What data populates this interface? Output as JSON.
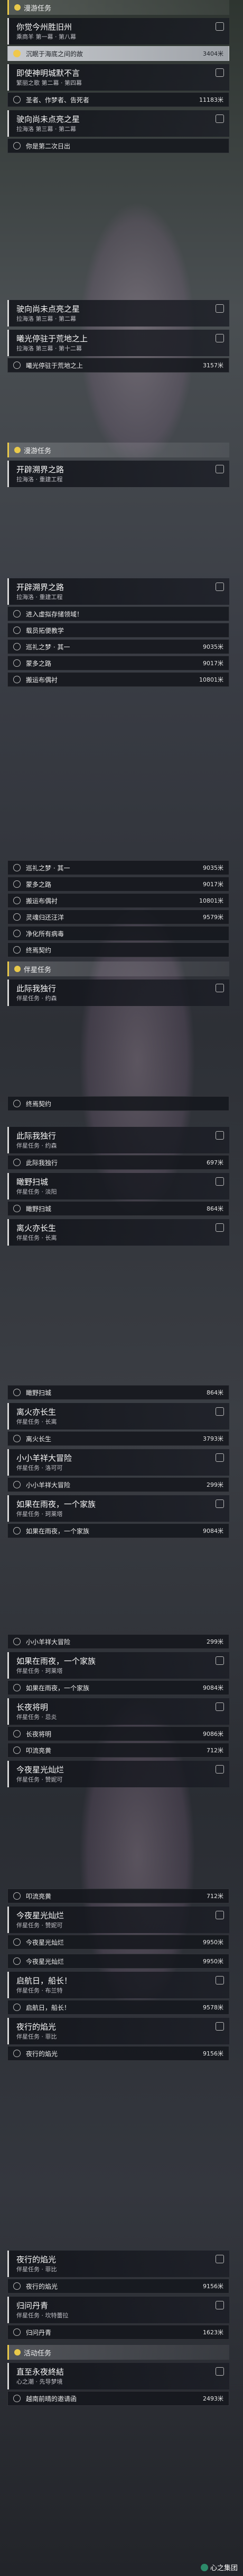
{
  "sections": {
    "dream": "漫游任务",
    "dream2": "漫游任务",
    "companion": "伴星任务",
    "activity": "活动任务"
  },
  "quests": {
    "q1": {
      "title": "你觉今州胜旧州",
      "sub": "乘商羊 第一幕 · 第八幕"
    },
    "q2": {
      "title": "即使神明城默不言",
      "sub": "繁丽之歌 第二幕 · 第四幕"
    },
    "q3": {
      "title": "驶向尚未点亮之星",
      "sub": "拉海洛 第三幕 · 第二幕"
    },
    "q4": {
      "title": "驶向尚未点亮之星",
      "sub": "拉海洛 第三幕 · 第二幕"
    },
    "q5": {
      "title": "曦光停驻于荒地之上",
      "sub": "拉海洛 第三幕 · 第十二幕"
    },
    "q6": {
      "title": "开辟溯界之路",
      "sub": "拉海洛 · 重建工程"
    },
    "q7": {
      "title": "开辟溯界之路",
      "sub": "拉海洛 · 重建工程"
    },
    "q8": {
      "title": "此际我独行",
      "sub": "伴星任务 · 约森"
    },
    "q9": {
      "title": "此际我独行",
      "sub": "伴星任务 · 约森"
    },
    "q10": {
      "title": "瞰野扫城",
      "sub": "伴星任务 · 淡阳"
    },
    "q11": {
      "title": "离火亦长生",
      "sub": "伴星任务 · 长离"
    },
    "q12": {
      "title": "离火亦长生",
      "sub": "伴星任务 · 长离"
    },
    "q13": {
      "title": "小小羊祥大冒险",
      "sub": "伴星任务 · 洛可可"
    },
    "q14": {
      "title": "如果在雨夜，一个家族",
      "sub": "伴星任务 · 珂莱塔"
    },
    "q15": {
      "title": "如果在雨夜，一个家族",
      "sub": "伴星任务 · 珂莱塔"
    },
    "q16": {
      "title": "长夜将明",
      "sub": "伴星任务 · 忌炎"
    },
    "q17": {
      "title": "今夜星光灿烂",
      "sub": "伴星任务 · 赞妮可"
    },
    "q18": {
      "title": "今夜星光灿烂",
      "sub": "伴星任务 · 赞妮可"
    },
    "q19": {
      "title": "启航日，船长！",
      "sub": "伴星任务 · 布兰特"
    },
    "q20": {
      "title": "夜行的焰光",
      "sub": "伴星任务 · 菲比"
    },
    "q21": {
      "title": "夜行的焰光",
      "sub": "伴星任务 · 菲比"
    },
    "q22": {
      "title": "归问丹青",
      "sub": "伴星任务 · 坎特蕾拉"
    },
    "q23": {
      "title": "直至永夜終結",
      "sub": "心之潮 · 先导梦境"
    }
  },
  "steps": {
    "s1": {
      "name": "沉眠于海底之间的故",
      "dist": "3404米"
    },
    "s2": {
      "name": "圣者、作梦者、告死者",
      "dist": "11183米"
    },
    "s3": {
      "name": "你是第二次日出",
      "dist": ""
    },
    "s4": {
      "name": "曦光停驻于荒地之上",
      "dist": "3157米"
    },
    "s5": {
      "name": "进入虚拟存储领域！",
      "dist": ""
    },
    "s6": {
      "name": "载员拓便教学",
      "dist": ""
    },
    "s7": {
      "name": "巡礼之梦 · 其一",
      "dist": "9035米"
    },
    "s8": {
      "name": "蒙多之路",
      "dist": "9017米"
    },
    "s9": {
      "name": "搬运布偶衬",
      "dist": "10801米"
    },
    "s10": {
      "name": "巡礼之梦 · 其一",
      "dist": "9035米"
    },
    "s11": {
      "name": "蒙多之路",
      "dist": "9017米"
    },
    "s12": {
      "name": "搬运布偶衬",
      "dist": "10801米"
    },
    "s13": {
      "name": "灵魂归还汪洋",
      "dist": "9579米"
    },
    "s14": {
      "name": "净化所有病毒",
      "dist": ""
    },
    "s15": {
      "name": "终焉契约",
      "dist": ""
    },
    "s16": {
      "name": "终焉契约",
      "dist": ""
    },
    "s17": {
      "name": "此际我独行",
      "dist": "697米"
    },
    "s18": {
      "name": "瞰野扫城",
      "dist": "864米"
    },
    "s19": {
      "name": "瞰野扫城",
      "dist": "864米"
    },
    "s20": {
      "name": "离火长生",
      "dist": "3793米"
    },
    "s21": {
      "name": "小小羊祥大冒险",
      "dist": "299米"
    },
    "s22": {
      "name": "小小羊祥大冒险",
      "dist": "299米"
    },
    "s23": {
      "name": "如果在雨夜，一个家族",
      "dist": "9084米"
    },
    "s24": {
      "name": "如果在雨夜，一个家族",
      "dist": "9084米"
    },
    "s25": {
      "name": "长夜将明",
      "dist": "9086米"
    },
    "s26": {
      "name": "叩流亮黄",
      "dist": "712米"
    },
    "s27": {
      "name": "叩流亮黄",
      "dist": "712米"
    },
    "s28": {
      "name": "今夜星光灿烂",
      "dist": "9950米"
    },
    "s29": {
      "name": "今夜星光灿烂",
      "dist": "9950米"
    },
    "s30": {
      "name": "启航日，船长！",
      "dist": "9578米"
    },
    "s31": {
      "name": "夜行的焰光",
      "dist": "9156米"
    },
    "s32": {
      "name": "夜行的焰光",
      "dist": "9156米"
    },
    "s33": {
      "name": "归问丹青",
      "dist": "1623米"
    },
    "s34": {
      "name": "越南前晴的邀请函",
      "dist": "2493米"
    }
  },
  "watermark": "心之集团"
}
